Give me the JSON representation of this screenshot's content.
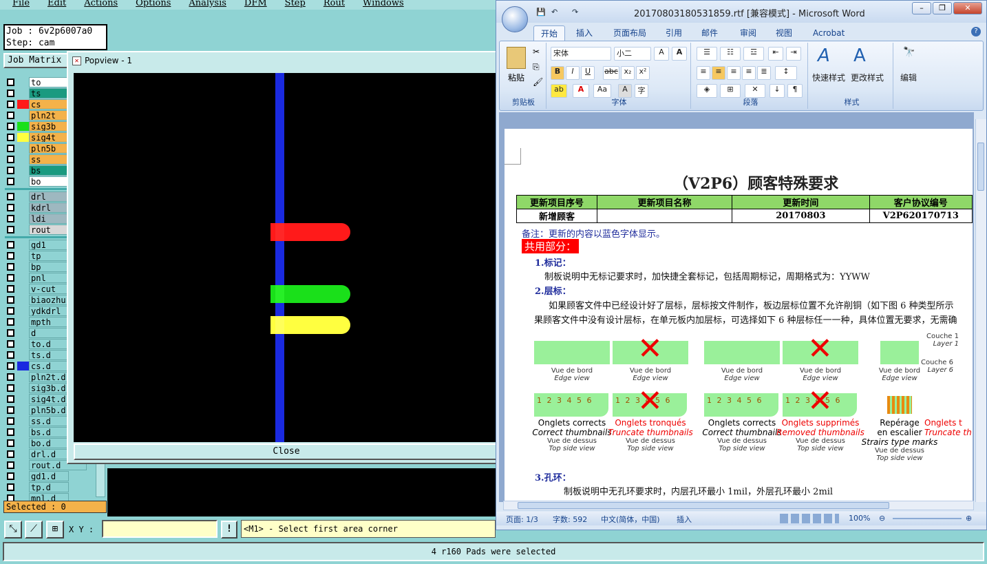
{
  "cam": {
    "menu": [
      "File",
      "Edit",
      "Actions",
      "Options",
      "Analysis",
      "DFM",
      "Step",
      "Rout",
      "Windows"
    ],
    "job_label": "Job : 6v2p6007a0",
    "step_label": "Step: cam",
    "job_matrix": "Job Matrix",
    "layers_group1": [
      {
        "name": "to",
        "color": "#ffffff"
      },
      {
        "name": "ts",
        "color": "#1a9a80"
      },
      {
        "name": "cs",
        "color": "#f4b24a"
      },
      {
        "name": "pln2t",
        "color": "#f4b24a"
      },
      {
        "name": "sig3b",
        "color": "#f4b24a"
      },
      {
        "name": "sig4t",
        "color": "#f4b24a"
      },
      {
        "name": "pln5b",
        "color": "#f4b24a"
      },
      {
        "name": "ss",
        "color": "#f4b24a"
      },
      {
        "name": "bs",
        "color": "#1a9a80"
      },
      {
        "name": "bo",
        "color": "#ffffff"
      }
    ],
    "layers_group2": [
      {
        "name": "drl",
        "color": "#9eb8c0"
      },
      {
        "name": "kdrl",
        "color": "#9eb8c0"
      },
      {
        "name": "ldi",
        "color": "#9eb8c0"
      },
      {
        "name": "rout",
        "color": "#d8d8d8"
      }
    ],
    "layers_group3": [
      "gd1",
      "tp",
      "bp",
      "pnl",
      "v-cut",
      "biaozhu",
      "ydkdrl",
      "mpth",
      "d",
      "to.d",
      "ts.d",
      "cs.d",
      "pln2t.d",
      "sig3b.d",
      "sig4t.d",
      "pln5b.d",
      "ss.d",
      "bs.d",
      "bo.d",
      "drl.d",
      "rout.d",
      "gd1.d",
      "tp.d",
      "mnl.d"
    ],
    "swatches": {
      "cs": "#ff1a1a",
      "sig3b": "#1ae01a",
      "sig4t": "#ffff40",
      "cs.d": "#1a2ae0"
    },
    "selected": "Selected : 0",
    "xy_label": "X Y :",
    "xy_value": "",
    "prompt": "<M1> - Select first area corner",
    "status": "4 r160 Pads were selected",
    "tool_icons": [
      "select-area-icon",
      "select-polygon-icon",
      "grid-icon"
    ],
    "info_button": "!"
  },
  "popview": {
    "title": "Popview - 1",
    "close": "Close",
    "pads": [
      {
        "color": "#ff1a1a",
        "row": 0
      },
      {
        "color": "#1ae01a",
        "row": 1
      },
      {
        "color": "#ffff40",
        "row": 2
      }
    ]
  },
  "word": {
    "title": "20170803180531859.rtf [兼容模式] - Microsoft Word",
    "tabs": [
      "开始",
      "插入",
      "页面布局",
      "引用",
      "邮件",
      "审阅",
      "视图",
      "Acrobat"
    ],
    "active_tab": "开始",
    "font_name": "宋体",
    "font_size": "小二",
    "groups": [
      "剪贴板",
      "字体",
      "段落",
      "样式",
      "编辑"
    ],
    "paste": "粘贴",
    "quick_styles": "快速样式",
    "change_styles": "更改样式",
    "edit_btn": "编辑",
    "doc_title": "（V2P6）顾客特殊要求",
    "table_header": [
      "更新项目序号",
      "更新项目名称",
      "更新时间",
      "客户协议编号"
    ],
    "table_row": [
      "新增顾客",
      "",
      "20170803",
      "V2P620170713"
    ],
    "note": "备注：更新的内容以蓝色字体显示。",
    "section": "共用部分：",
    "item1_title": "1.标记：",
    "item1_text": "制板说明中无标记要求时，加快捷全套标记，包括周期标记，周期格式为：YYWW",
    "item2_title": "2.层标：",
    "item2_text1": "如果顾客文件中已经设计好了层标，层标按文件制作，板边层标位置不允许削铜（如下图 6 种类型所示",
    "item2_text2": "果顾客文件中没有设计层标，在单元板内加层标，可选择如下 6 种层标任一一种，具体位置无要求，无需确",
    "item3_title": "3.孔环：",
    "item3_text": "制板说明中无孔环要求时，内层孔环最小 1mil，外层孔环最小 2mil",
    "fig_edge": "Vue de bord",
    "fig_edge_en": "Edge view",
    "fig_top": "Vue de dessus",
    "fig_top_en": "Top side view",
    "fig_couche1": "Couche 1",
    "fig_layer1": "Layer 1",
    "fig_couche6": "Couche 6",
    "fig_layer6": "Layer 6",
    "cap_ok1": "Onglets corrects",
    "cap_ok1_en": "Correct thumbnails",
    "cap_bad1": "Onglets tronqués",
    "cap_bad1_en": "Truncate thumbnails",
    "cap_ok2": "Onglets corrects",
    "cap_ok2_en": "Correct thumbnails",
    "cap_bad2": "Onglets supprimés",
    "cap_bad2_en": "Removed thumbnails",
    "cap_stair1": "Repérage",
    "cap_stair2": "en escalier",
    "cap_stair_en": "Strairs type marks",
    "cap_trunc_cut": "Onglets t",
    "cap_trunc_cut_en": "Truncate th",
    "thumb_nums": "1 2 3 4 5 6",
    "status_page": "页面: 1/3",
    "status_words": "字数: 592",
    "status_lang": "中文(简体，中国)",
    "status_insert": "插入",
    "zoom": "100%"
  }
}
